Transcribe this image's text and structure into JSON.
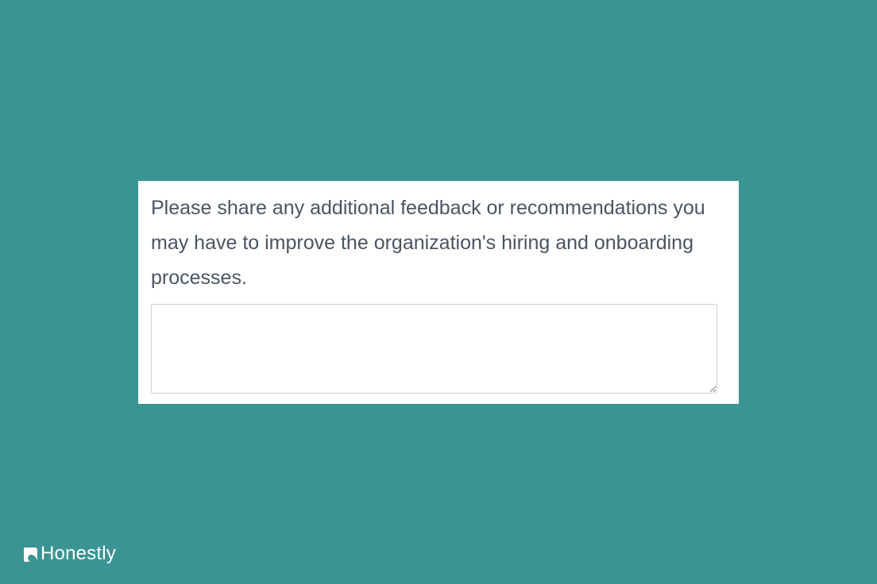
{
  "survey": {
    "question": "Please share any additional feedback or recommendations you may have to improve the organization's hiring and onboarding processes.",
    "answer_value": "",
    "answer_placeholder": ""
  },
  "brand": {
    "name": "Honestly",
    "icon": "honestly-logo-icon"
  },
  "colors": {
    "background": "#3a9493",
    "card": "#ffffff",
    "question_text": "#4a5563",
    "input_border": "#cfd4da"
  }
}
